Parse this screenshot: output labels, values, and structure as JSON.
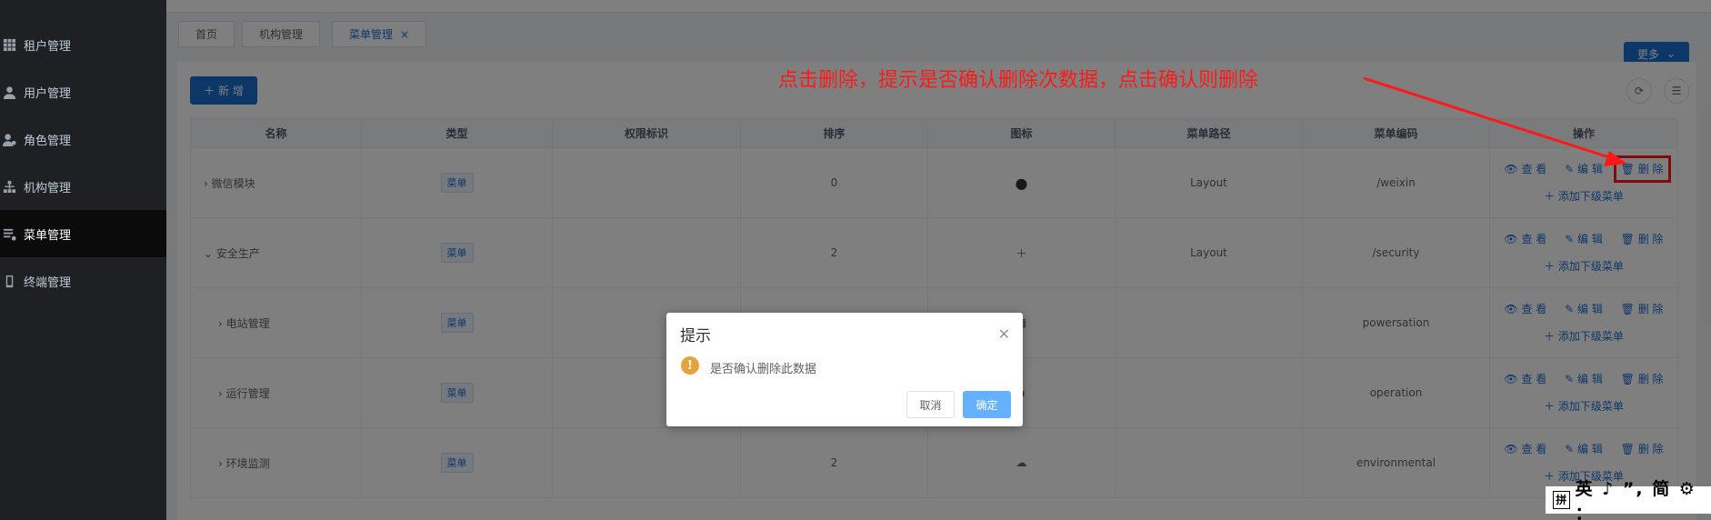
{
  "sidebar": {
    "items": [
      {
        "label": "租户管理",
        "icon": "grid-icon"
      },
      {
        "label": "用户管理",
        "icon": "user-icon"
      },
      {
        "label": "角色管理",
        "icon": "role-icon"
      },
      {
        "label": "机构管理",
        "icon": "org-tree-icon"
      },
      {
        "label": "菜单管理",
        "icon": "menu-list-icon",
        "active": true
      },
      {
        "label": "终端管理",
        "icon": "device-icon"
      }
    ]
  },
  "tabs": [
    {
      "label": "首页"
    },
    {
      "label": "机构管理"
    },
    {
      "label": "菜单管理",
      "active": true,
      "close": "×"
    }
  ],
  "toolbar": {
    "more_label": "更多",
    "add_label": "＋ 新 增"
  },
  "table": {
    "columns": [
      "名称",
      "类型",
      "权限标识",
      "排序",
      "图标",
      "菜单路径",
      "菜单编码",
      "操作"
    ],
    "rows": [
      {
        "name": "微信模块",
        "expander": "›",
        "type": "菜单",
        "perm": "",
        "sort": "0",
        "icon": "wechat-icon",
        "path": "Layout",
        "code": "/weixin"
      },
      {
        "name": "安全生产",
        "expander": "⌄",
        "type": "菜单",
        "perm": "",
        "sort": "2",
        "icon": "plus-icon",
        "path": "Layout",
        "code": "/security"
      },
      {
        "name": "电站管理",
        "expander": "›",
        "type": "菜单",
        "perm": "",
        "sort": "",
        "icon": "grid-icon",
        "path": "",
        "code": "powersation"
      },
      {
        "name": "运行管理",
        "expander": "›",
        "type": "菜单",
        "perm": "",
        "sort": "",
        "icon": "box-icon",
        "path": "",
        "code": "operation"
      },
      {
        "name": "环境监测",
        "expander": "›",
        "type": "菜单",
        "perm": "",
        "sort": "2",
        "icon": "cloud-icon",
        "path": "",
        "code": "environmental"
      }
    ],
    "ops": {
      "view": "查 看",
      "edit": "编 辑",
      "delete": "删 除",
      "add_child": "添加下级菜单"
    }
  },
  "dialog": {
    "title": "提示",
    "message": "是否确认删除此数据",
    "cancel": "取消",
    "ok": "确定"
  },
  "annotation": "点击删除，提示是否确认删除次数据，点击确认则删除",
  "ime": {
    "box": "拼",
    "text": "英 ♪ ”, 简 ⚙ ："
  },
  "colors": {
    "primary": "#1b6fd3",
    "annotation": "#ff1a1a",
    "warning": "#e6a23c"
  }
}
